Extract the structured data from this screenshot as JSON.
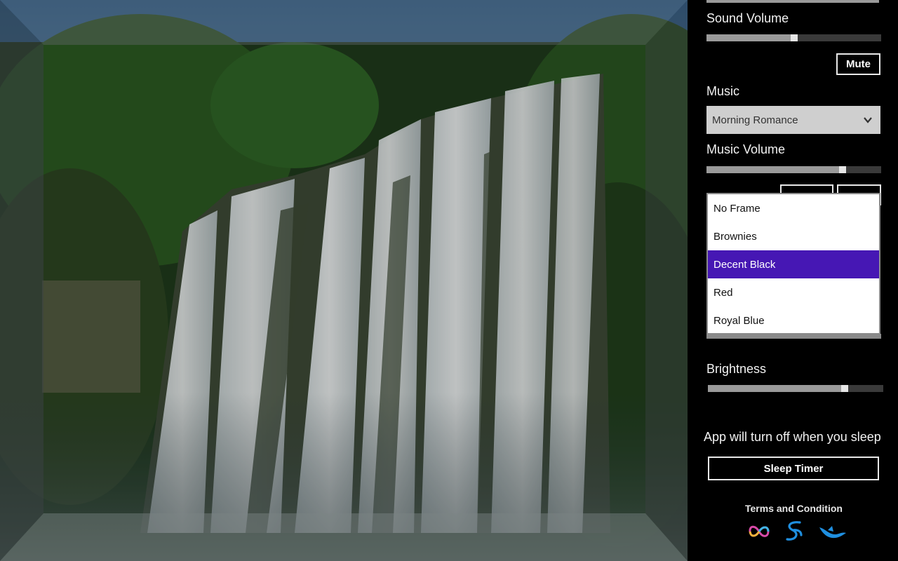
{
  "scene": {
    "description_icon": "waterfall-photo"
  },
  "panel": {
    "sound_volume": {
      "label": "Sound Volume",
      "level": 0.5
    },
    "mute_label": "Mute",
    "music": {
      "label": "Music",
      "selected": "Morning Romance",
      "chevron": "chevron-down-icon"
    },
    "music_volume": {
      "label": "Music Volume",
      "level": 0.78
    },
    "frame_dropdown": {
      "options": [
        "No Frame",
        "Brownies",
        "Decent Black",
        "Red",
        "Royal Blue"
      ],
      "selected_index": 2
    },
    "brightness": {
      "label": "Brightness",
      "level": 0.78
    },
    "sleep_note": "App will turn off when you sleep",
    "sleep_timer_label": "Sleep Timer",
    "terms_label": "Terms and Condition",
    "footer_icons": [
      "infinity-logo-icon",
      "swirl-logo-icon",
      "bird-logo-icon"
    ]
  },
  "colors": {
    "accent_selected": "#4617b4",
    "panel_bg": "#000000"
  }
}
